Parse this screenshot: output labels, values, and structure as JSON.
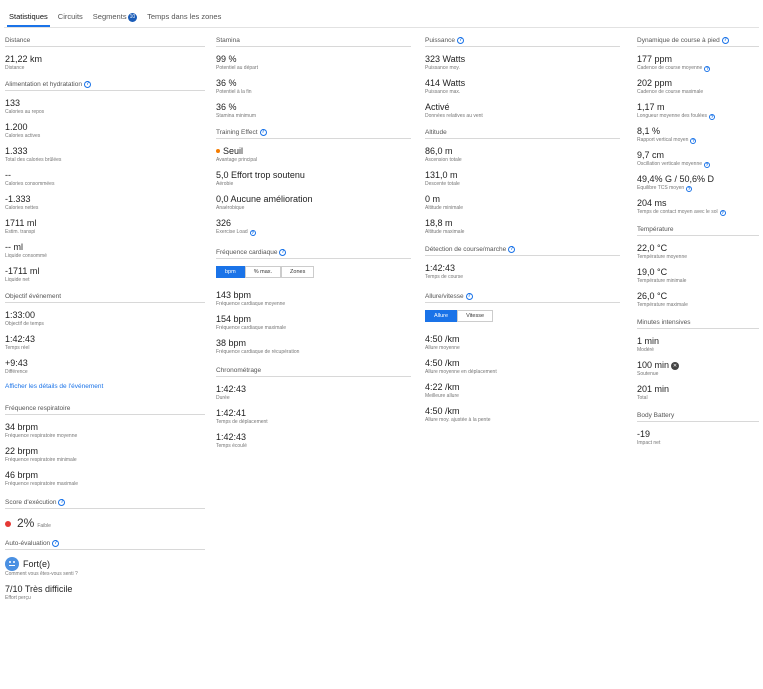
{
  "tabs": [
    {
      "label": "Statistiques"
    },
    {
      "label": "Circuits"
    },
    {
      "label": "Segments",
      "count": "10"
    },
    {
      "label": "Temps dans les zones"
    }
  ],
  "col1": {
    "distance": {
      "title": "Distance",
      "value": "21,22 km",
      "label": "Distance"
    },
    "nutrition": {
      "title": "Alimentation et hydratation",
      "stats": [
        {
          "value": "133",
          "label": "Calories au repos"
        },
        {
          "value": "1.200",
          "label": "Calories actives"
        },
        {
          "value": "1.333",
          "label": "Total des calories brûlées"
        },
        {
          "value": "--",
          "label": "Calories consommées"
        },
        {
          "value": "-1.333",
          "label": "Calories nettes"
        },
        {
          "value": "1711 ml",
          "label": "Estim. transpi"
        },
        {
          "value": "-- ml",
          "label": "Liquide consommé"
        },
        {
          "value": "-1711 ml",
          "label": "Liquide net"
        }
      ]
    },
    "event": {
      "title": "Objectif événement",
      "stats": [
        {
          "value": "1:33:00",
          "label": "Objectif de temps"
        },
        {
          "value": "1:42:43",
          "label": "Temps réel"
        },
        {
          "value": "+9:43",
          "label": "Différence"
        }
      ],
      "link": "Afficher les détails de l'événement"
    },
    "respiration": {
      "title": "Fréquence respiratoire",
      "stats": [
        {
          "value": "34 brpm",
          "label": "Fréquence respiratoire moyenne"
        },
        {
          "value": "22 brpm",
          "label": "Fréquence respiratoire minimale"
        },
        {
          "value": "46 brpm",
          "label": "Fréquence respiratoire maximale"
        }
      ]
    },
    "execution": {
      "title": "Score d'exécution",
      "value": "2%",
      "label": "Faible",
      "color": "#e53935"
    },
    "self_eval": {
      "title": "Auto-évaluation",
      "feel": "Fort(e)",
      "feel_label": "Comment vous êtes-vous senti ?",
      "effort": "7/10 Très difficile",
      "effort_label": "Effort perçu"
    }
  },
  "col2": {
    "stamina": {
      "title": "Stamina",
      "stats": [
        {
          "value": "99 %",
          "label": "Potentiel au départ"
        },
        {
          "value": "36 %",
          "label": "Potentiel à la fin"
        },
        {
          "value": "36 %",
          "label": "Stamina minimum"
        }
      ]
    },
    "training_effect": {
      "title": "Training Effect",
      "primary": "Seuil",
      "primary_label": "Avantage principal",
      "primary_color": "#f57c00",
      "stats": [
        {
          "value": "5,0 Effort trop soutenu",
          "label": "Aérobie"
        },
        {
          "value": "0,0 Aucune amélioration",
          "label": "Anaérobique"
        }
      ],
      "load": "326",
      "load_label": "Exercise Load"
    },
    "heart_rate": {
      "title": "Fréquence cardiaque",
      "toggle": [
        "bpm",
        "% max.",
        "Zones"
      ],
      "stats": [
        {
          "value": "143 bpm",
          "label": "Fréquence cardiaque moyenne"
        },
        {
          "value": "154 bpm",
          "label": "Fréquence cardiaque maximale"
        },
        {
          "value": "38 bpm",
          "label": "Fréquence cardiaque de récupération"
        }
      ]
    },
    "timing": {
      "title": "Chronométrage",
      "stats": [
        {
          "value": "1:42:43",
          "label": "Durée"
        },
        {
          "value": "1:42:41",
          "label": "Temps de déplacement"
        },
        {
          "value": "1:42:43",
          "label": "Temps écoulé"
        }
      ]
    }
  },
  "col3": {
    "power": {
      "title": "Puissance",
      "stats": [
        {
          "value": "323 Watts",
          "label": "Puissance moy."
        },
        {
          "value": "414 Watts",
          "label": "Puissance max."
        },
        {
          "value": "Activé",
          "label": "Données relatives au vent"
        }
      ]
    },
    "altitude": {
      "title": "Altitude",
      "stats": [
        {
          "value": "86,0 m",
          "label": "Ascension totale"
        },
        {
          "value": "131,0 m",
          "label": "Descente totale"
        },
        {
          "value": "0 m",
          "label": "Altitude minimale"
        },
        {
          "value": "18,8 m",
          "label": "Altitude maximale"
        }
      ]
    },
    "run_walk": {
      "title": "Détection de course/marche",
      "value": "1:42:43",
      "label": "Temps de course"
    },
    "pace": {
      "title": "Allure/vitesse",
      "toggle": [
        "Allure",
        "Vitesse"
      ],
      "stats": [
        {
          "value": "4:50 /km",
          "label": "Allure moyenne"
        },
        {
          "value": "4:50 /km",
          "label": "Allure moyenne en déplacement"
        },
        {
          "value": "4:22 /km",
          "label": "Meilleure allure"
        },
        {
          "value": "4:50 /km",
          "label": "Allure moy. ajustée à la pente"
        }
      ]
    }
  },
  "col4": {
    "dynamics": {
      "title": "Dynamique de course à pied",
      "stats": [
        {
          "value": "177 ppm",
          "label": "Cadence de course moyenne",
          "help": true
        },
        {
          "value": "202 ppm",
          "label": "Cadence de course maximale",
          "help": false
        },
        {
          "value": "1,17 m",
          "label": "Longueur moyenne des foulées",
          "help": true
        },
        {
          "value": "8,1 %",
          "label": "Rapport vertical moyen",
          "help": true
        },
        {
          "value": "9,7 cm",
          "label": "Oscillation verticale moyenne",
          "help": true
        },
        {
          "value": "49,4% G / 50,6% D",
          "label": "Equilibre TCS moyen",
          "help": true
        },
        {
          "value": "204 ms",
          "label": "Temps de contact moyen avec le sol",
          "help": true
        }
      ]
    },
    "temperature": {
      "title": "Température",
      "stats": [
        {
          "value": "22,0 °C",
          "label": "Température moyenne"
        },
        {
          "value": "19,0 °C",
          "label": "Température minimale"
        },
        {
          "value": "26,0 °C",
          "label": "Température maximale"
        }
      ]
    },
    "intensity": {
      "title": "Minutes intensives",
      "stats": [
        {
          "value": "1 min",
          "label": "Modéré"
        },
        {
          "value": "100 min",
          "label": "Soutenue"
        },
        {
          "value": "201 min",
          "label": "Total"
        }
      ]
    },
    "body_battery": {
      "title": "Body Battery",
      "value": "-19",
      "label": "Impact net"
    }
  }
}
